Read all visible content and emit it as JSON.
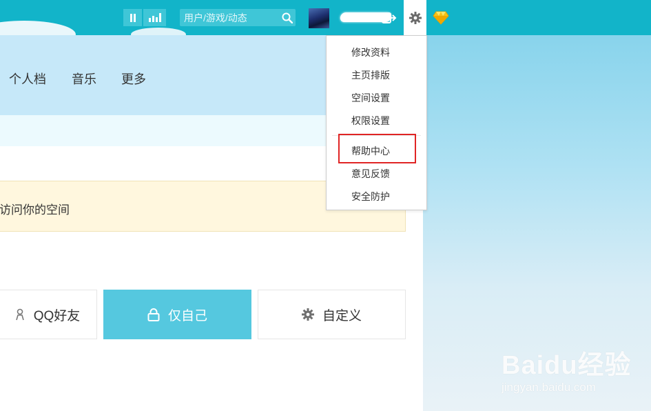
{
  "topbar": {
    "search_placeholder": "用户/游戏/动态",
    "icons": [
      "pause-icon",
      "equalizer-icon",
      "search-icon",
      "logout-icon",
      "gear-icon",
      "diamond-icon"
    ]
  },
  "nav": {
    "items": [
      "个人档",
      "音乐",
      "更多"
    ]
  },
  "notice": {
    "text": "访问你的空间"
  },
  "permissions": {
    "options": [
      {
        "label": "QQ好友",
        "icon": "friends-icon"
      },
      {
        "label": "仅自己",
        "icon": "lock-icon"
      },
      {
        "label": "自定义",
        "icon": "gear-icon"
      }
    ],
    "selected": "仅自己"
  },
  "settings_menu": {
    "items": [
      "修改资料",
      "主页排版",
      "空间设置",
      "权限设置",
      "帮助中心",
      "意见反馈",
      "安全防护"
    ],
    "highlighted": "帮助中心"
  },
  "watermark": {
    "logo": "Baidu经验",
    "url": "jingyan.baidu.com"
  },
  "colors": {
    "topbar": "#12b4c9",
    "nav_band": "#c6e8f9",
    "selected_option": "#55c8df",
    "highlight_box": "#e02424"
  }
}
